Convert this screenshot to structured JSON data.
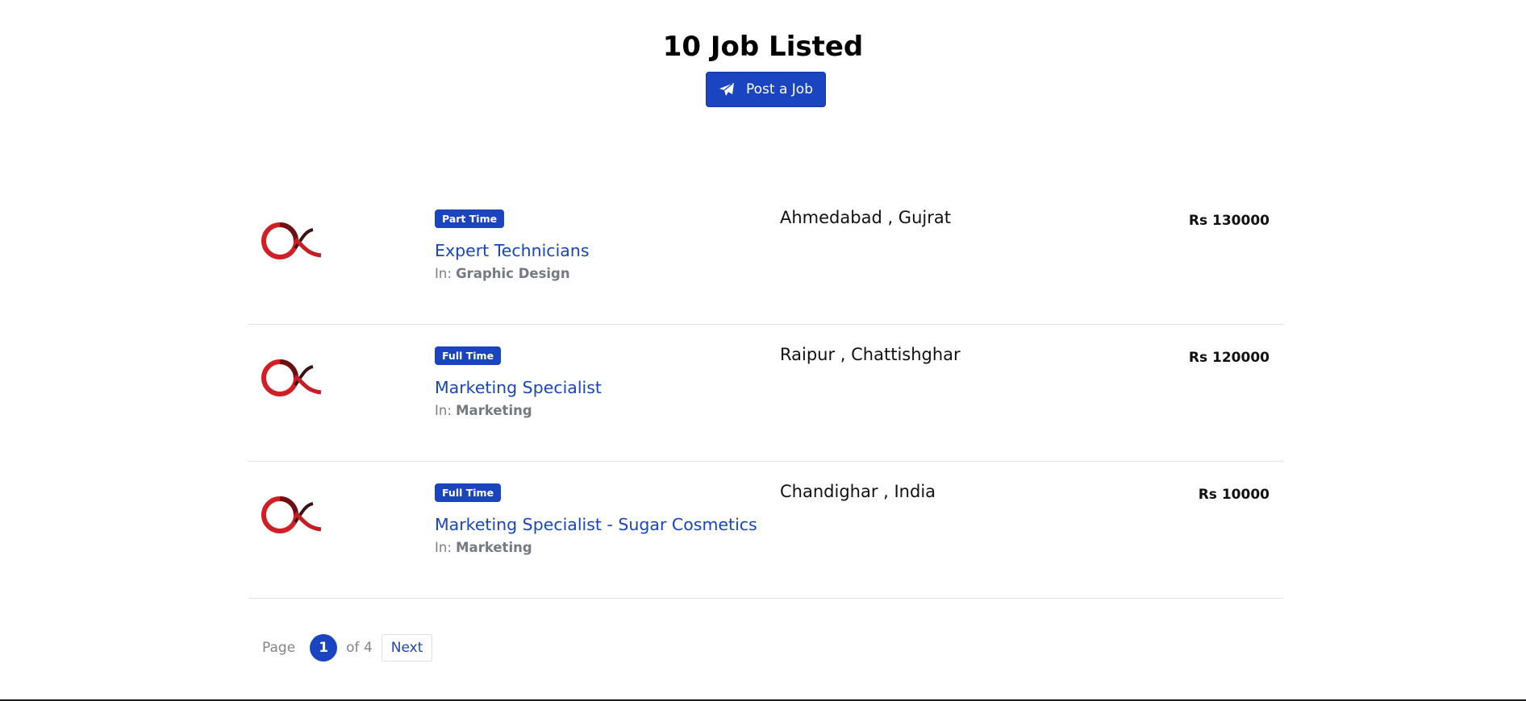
{
  "header": {
    "title": "10 Job Listed",
    "post_button_label": "Post a Job",
    "accent_color": "#1a44c0"
  },
  "jobs": [
    {
      "type": "Part Time",
      "title": "Expert Technicians",
      "category_prefix": "In:",
      "category": "Graphic Design",
      "location": "Ahmedabad , Gujrat",
      "salary": "Rs 130000",
      "logo": "company-logo-icon"
    },
    {
      "type": "Full Time",
      "title": "Marketing Specialist",
      "category_prefix": "In:",
      "category": "Marketing",
      "location": "Raipur , Chattishghar",
      "salary": "Rs 120000",
      "logo": "company-logo-icon"
    },
    {
      "type": "Full Time",
      "title": "Marketing Specialist - Sugar Cosmetics",
      "category_prefix": "In:",
      "category": "Marketing",
      "location": "Chandighar , India",
      "salary": "Rs 10000",
      "logo": "company-logo-icon"
    }
  ],
  "pagination": {
    "page_label": "Page",
    "current": "1",
    "of_label": "of 4",
    "next_label": "Next"
  }
}
